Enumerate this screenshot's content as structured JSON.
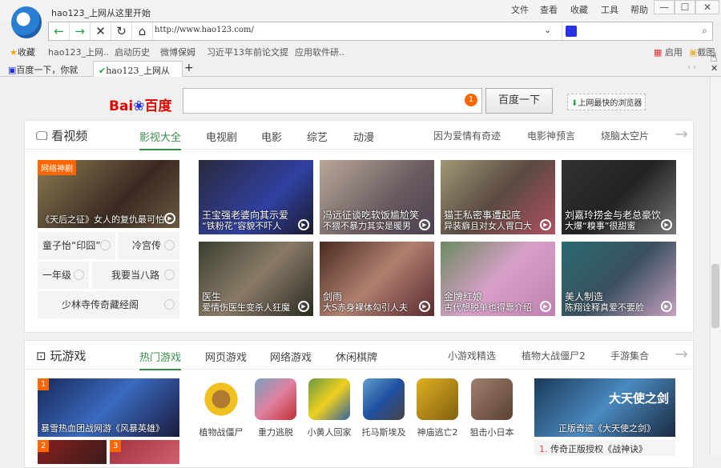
{
  "window": {
    "title": "hao123_上网从这里开始",
    "menu": [
      "文件",
      "查看",
      "收藏",
      "工具",
      "帮助"
    ],
    "controls": [
      "—",
      "☐",
      "✕"
    ]
  },
  "nav": {
    "url": "http://www.hao123.com/",
    "search_placeholder": ""
  },
  "bookmarks": {
    "fav_label": "收藏",
    "items": [
      "hao123_上网..",
      "启动历史",
      "微博保姆",
      "习近平13年前论文提",
      "应用软件研.."
    ],
    "right": [
      "启用",
      "截图"
    ]
  },
  "tabs": [
    {
      "label": "百度一下，你就"
    },
    {
      "label": "hao123_上网从"
    }
  ],
  "baidu": {
    "logo": "Bai du 百度",
    "badge": "1",
    "button": "百度一下",
    "download": "上网最快的浏览器"
  },
  "video": {
    "title": "看视频",
    "tabs": [
      "影视大全",
      "电视剧",
      "电影",
      "综艺",
      "动漫"
    ],
    "links": [
      "因为爱情有奇迹",
      "电影神预言",
      "烧脑太空片"
    ],
    "feature": {
      "tag": "网络神剧",
      "caption": "《天后之征》女人的复仇最可怕"
    },
    "small": [
      "童子怡“印囧”",
      "冷宫传",
      "一年级",
      "我要当八路",
      "少林寺传奇藏经阁"
    ],
    "tiles": [
      {
        "title": "王宝强老婆向其示爱",
        "sub": "“铁粉花”容貌不吓人"
      },
      {
        "title": "冯远征谈吃软饭尴尬笑",
        "sub": "不猥不暴力其实是暖男"
      },
      {
        "title": "猫王私密事遭起底",
        "sub": "异装癖且对女人胃口大"
      },
      {
        "title": "刘嘉玲捞金与老总豪饮",
        "sub": "大爆“糗事”很甜蜜"
      },
      {
        "title": "医生",
        "sub": "爱情伤医生变杀人狂魔"
      },
      {
        "title": "剑雨",
        "sub": "大S赤身裸体勾引人夫"
      },
      {
        "title": "金牌红娘",
        "sub": "古代想脱单也得靠介绍"
      },
      {
        "title": "美人制造",
        "sub": "陈翔诠释真爱不要脸"
      }
    ]
  },
  "games": {
    "title": "玩游戏",
    "tabs": [
      "热门游戏",
      "网页游戏",
      "网络游戏",
      "休闲棋牌"
    ],
    "links": [
      "小游戏精选",
      "植物大战僵尸2",
      "手游集合"
    ],
    "banner": {
      "rank": "1",
      "caption": "暴雪热血团战网游《风暴英雄》"
    },
    "ranks": [
      "2",
      "3"
    ],
    "icons": [
      "植物战僵尸",
      "重力逃脱",
      "小黄人回家",
      "托马斯埃及",
      "神庙逃亡2",
      "狙击小日本"
    ],
    "right_banner": {
      "title": "大天使之剑",
      "caption": "正版奇迹《大天使之剑》"
    },
    "list": [
      {
        "num": "1.",
        "text": "传奇正版授权《战神诀》"
      }
    ]
  }
}
